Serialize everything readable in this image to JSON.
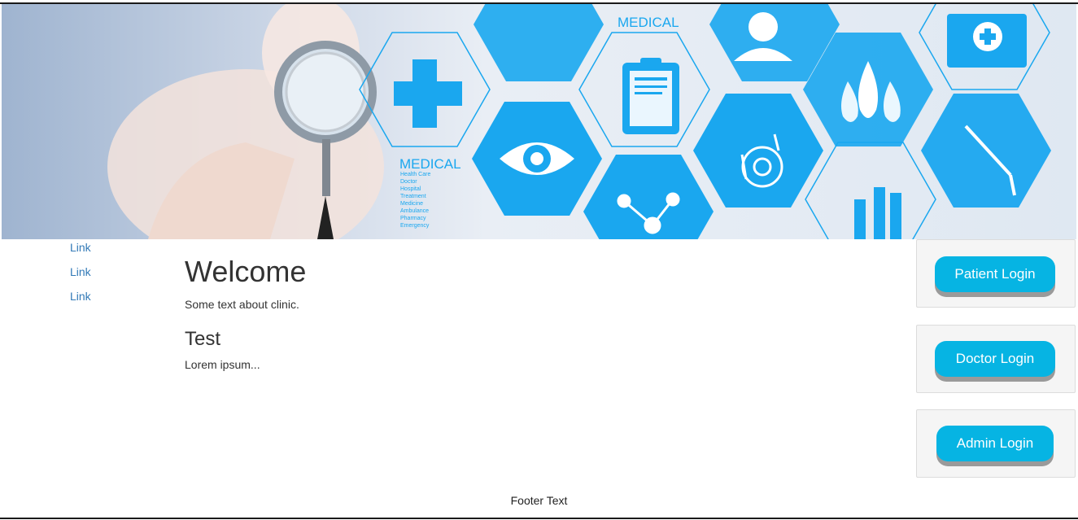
{
  "banner": {
    "text_medical_top": "MEDICAL",
    "text_medical_mid": "MEDICAL",
    "small_lines": [
      "Health Care",
      "Doctor",
      "Hospital",
      "Treatment",
      "Medicine",
      "Ambulance",
      "Pharmacy",
      "Emergency"
    ],
    "accent": "#1aa7ef"
  },
  "nav": {
    "items": [
      "Link",
      "Link",
      "Link"
    ]
  },
  "main": {
    "title": "Welcome",
    "intro": "Some text about clinic.",
    "subtitle": "Test",
    "body": "Lorem ipsum..."
  },
  "sidebar": {
    "patient_login": "Patient Login",
    "doctor_login": "Doctor Login",
    "admin_login": "Admin Login"
  },
  "footer": {
    "text": "Footer Text"
  },
  "colors": {
    "button": "#06b4e3",
    "link": "#337ab7",
    "panel": "#f5f5f5"
  }
}
